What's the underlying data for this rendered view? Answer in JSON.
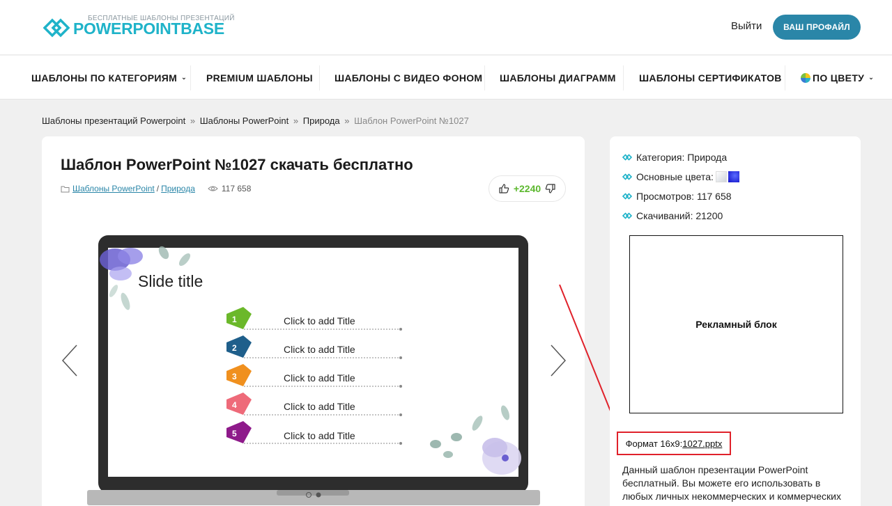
{
  "header": {
    "logo_tagline": "БЕСПЛАТНЫЕ ШАБЛОНЫ ПРЕЗЕНТАЦИЙ",
    "logo_text": "POWERPOINTBASE",
    "logout_label": "Выйти",
    "profile_label": "ВАШ ПРОФАЙЛ",
    "brand_color": "#1fb3c9",
    "button_color": "#2a86a8"
  },
  "nav": {
    "items": [
      {
        "label": "ШАБЛОНЫ ПО КАТЕГОРИЯМ",
        "has_dropdown": true
      },
      {
        "label": "PREMIUM ШАБЛОНЫ",
        "has_dropdown": false
      },
      {
        "label": "ШАБЛОНЫ С ВИДЕО ФОНОМ",
        "has_dropdown": false
      },
      {
        "label": "ШАБЛОНЫ ДИАГРАММ",
        "has_dropdown": false
      },
      {
        "label": "ШАБЛОНЫ СЕРТИФИКАТОВ",
        "has_dropdown": false
      },
      {
        "label": "ПО ЦВЕТУ",
        "has_dropdown": true
      }
    ]
  },
  "breadcrumb": {
    "items": [
      "Шаблоны презентаций Powerpoint",
      "Шаблоны PowerPoint",
      "Природа"
    ],
    "separator": "»",
    "current": "Шаблон PowerPoint №1027"
  },
  "post": {
    "title": "Шаблон PowerPoint №1027 скачать бесплатно",
    "category_links": [
      "Шаблоны PowerPoint",
      "Природа"
    ],
    "category_separator": "/",
    "views": "117 658",
    "vote_count": "+2240"
  },
  "slide": {
    "title": "Slide title",
    "items": [
      {
        "num": "1",
        "label": "Click to add Title",
        "color": "#6bb82a"
      },
      {
        "num": "2",
        "label": "Click to add Title",
        "color": "#1f5f8b"
      },
      {
        "num": "3",
        "label": "Click to add Title",
        "color": "#f0901e"
      },
      {
        "num": "4",
        "label": "Click to add Title",
        "color": "#ee6a79"
      },
      {
        "num": "5",
        "label": "Click to add Title",
        "color": "#8e1a8a"
      }
    ]
  },
  "sidebar": {
    "category_label": "Категория:",
    "category_value": "Природа",
    "colors_label": "Основные цвета:",
    "views_label": "Просмотров:",
    "views_value": "117 658",
    "downloads_label": "Скачиваний:",
    "downloads_value": "21200",
    "ad_label": "Рекламный блок",
    "format_label": "Формат 16x9:",
    "format_file": "1027.pptx",
    "description": "Данный шаблон презентации PowerPoint бесплатный. Вы можете его использовать в любых личных некоммерческих и коммерческих"
  }
}
